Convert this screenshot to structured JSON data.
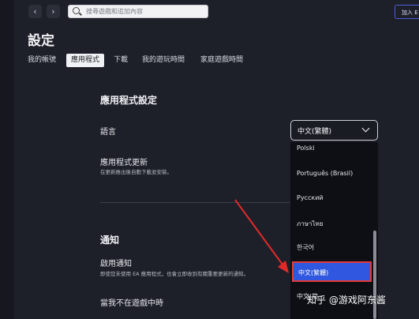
{
  "nav": {
    "back_glyph": "‹",
    "forward_glyph": "›",
    "search_placeholder": "搜尋遊戲和追加內容",
    "join_label": "加入 E"
  },
  "page": {
    "title": "設定"
  },
  "tabs": [
    {
      "label": "我的帳號",
      "active": false
    },
    {
      "label": "應用程式",
      "active": true
    },
    {
      "label": "下載",
      "active": false
    },
    {
      "label": "我的遊玩時間",
      "active": false
    },
    {
      "label": "家庭遊戲時間",
      "active": false
    }
  ],
  "app_settings": {
    "title": "應用程式設定",
    "language_label": "語言",
    "language_value": "中文(繁體)",
    "update_label": "應用程式更新",
    "update_desc": "在更新推出後自動下載並安裝。"
  },
  "notifications": {
    "title": "通知",
    "enable_label": "啟用通知",
    "enable_desc": "即使您未使用 EA 應用程式，也會立即收到有關重要更新的通知。",
    "not_in_game_label": "當我不在遊戲中時"
  },
  "language_options": [
    {
      "label": "Polski",
      "selected": false
    },
    {
      "label": "Português (Brasil)",
      "selected": false
    },
    {
      "label": "Русский",
      "selected": false
    },
    {
      "label": "ภาษาไทย",
      "selected": false
    },
    {
      "label": "한국어",
      "selected": false
    },
    {
      "label": "中文(繁體)",
      "selected": true
    },
    {
      "label": "中文(简",
      "selected": false
    }
  ],
  "watermark": "知乎 @游戏阿东酱",
  "colors": {
    "background": "#1e2029",
    "accent": "#2f57e0",
    "highlight_border": "#e13b3b",
    "arrow": "#e02a2a"
  }
}
